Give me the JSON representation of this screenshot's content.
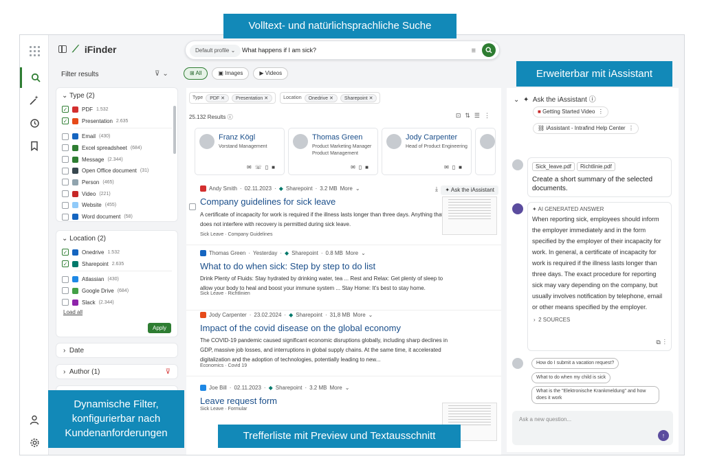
{
  "callouts": {
    "top": "Volltext- und natürlichsprachliche Suche",
    "right": "Erweiterbar mit iAssistant",
    "left": "Dynamische Filter, konfigurierbar nach Kundenanforderungen",
    "bottom": "Trefferliste mit Preview und Textausschnitt"
  },
  "app": {
    "name": "iFinder"
  },
  "search": {
    "profile": "Default profile",
    "query": "What happens if I am sick?"
  },
  "filters": {
    "header": "Filter results",
    "type": {
      "title": "Type (2)",
      "items": [
        {
          "label": "PDF",
          "count": "1.532",
          "checked": true,
          "color": "#d32f2f"
        },
        {
          "label": "Presentation",
          "count": "2.635",
          "checked": true,
          "color": "#e64a19"
        },
        {
          "label": "Email",
          "count": "(430)",
          "checked": false,
          "color": "#1565c0"
        },
        {
          "label": "Excel spreadsheet",
          "count": "(684)",
          "checked": false,
          "color": "#2e7d32"
        },
        {
          "label": "Message",
          "count": "(2.344)",
          "checked": false,
          "color": "#2e7d32"
        },
        {
          "label": "Open Office document",
          "count": "(31)",
          "checked": false,
          "color": "#37474f"
        },
        {
          "label": "Person",
          "count": "(465)",
          "checked": false,
          "color": "#90a4ae"
        },
        {
          "label": "Video",
          "count": "(221)",
          "checked": false,
          "color": "#c62828"
        },
        {
          "label": "Website",
          "count": "(455)",
          "checked": false,
          "color": "#90caf9"
        },
        {
          "label": "Word document",
          "count": "(58)",
          "checked": false,
          "color": "#1565c0"
        }
      ]
    },
    "location": {
      "title": "Location (2)",
      "items": [
        {
          "label": "Onedrive",
          "count": "1.532",
          "checked": true,
          "color": "#1565c0"
        },
        {
          "label": "Sharepoint",
          "count": "2.635",
          "checked": true,
          "color": "#00796b"
        },
        {
          "label": "Atlassian",
          "count": "(430)",
          "checked": false,
          "color": "#1e88e5"
        },
        {
          "label": "Google Drive",
          "count": "(684)",
          "checked": false,
          "color": "#43a047"
        },
        {
          "label": "Slack",
          "count": "(2.344)",
          "checked": false,
          "color": "#8e24aa"
        }
      ],
      "load_all": "Load all",
      "apply": "Apply"
    },
    "date": "Date",
    "author": "Author (1)"
  },
  "tabs": [
    "All",
    "Images",
    "Videos"
  ],
  "active_filters": {
    "type_label": "Type",
    "type_chips": [
      "PDF",
      "Presentation"
    ],
    "location_label": "Location",
    "location_chips": [
      "Onedrive",
      "Sharepoint"
    ]
  },
  "results_count": "25.132 Results",
  "people": [
    {
      "name": "Franz Kögl",
      "role": "Vorstand Management"
    },
    {
      "name": "Thomas Green",
      "role": "Product Marketing Manager Product Management"
    },
    {
      "name": "Jody Carpenter",
      "role": "Head of Product Engineering"
    }
  ],
  "results": [
    {
      "author": "Andy Smith",
      "date": "02.11.2023",
      "source": "Sharepoint",
      "size": "3.2 MB",
      "more": "More",
      "title": "Company guidelines for sick leave",
      "text": "A certificate of incapacity for work is required if the illness lasts longer than three days. Anything that does not interfere with recovery is permitted during sick leave.",
      "tags": "Sick Leave · Company Guidelines",
      "ask": "Ask the iAssistant",
      "filecolor": "#d32f2f"
    },
    {
      "author": "Thomas Green",
      "date": "Yesterday",
      "source": "Sharepoint",
      "size": "0.8 MB",
      "more": "More",
      "title": "What to do when sick: Step by step to do list",
      "text": "Drink Plenty of Fluids: Stay hydrated by drinking water, tea ... Rest and Relax: Get plenty of sleep to allow your body to heal and boost your immune system ... Stay Home: It's best to stay home.",
      "tags": "Sick Leave · Richtlinien",
      "filecolor": "#1565c0"
    },
    {
      "author": "Jody Carpenter",
      "date": "23.02.2024",
      "source": "Sharepoint",
      "size": "31,8 MB",
      "more": "More",
      "title": "Impact of the covid disease on the global economy",
      "text": "The COVID-19 pandemic caused significant economic disruptions globally, including sharp declines in GDP, massive job losses, and interruptions in global supply chains. At the same time, it accelerated digitalization and the adoption of technologies, potentially leading to new...",
      "tags": "Economics · Covid 19",
      "filecolor": "#e64a19"
    },
    {
      "author": "Joe Bill",
      "date": "02.11.2023",
      "source": "Sharepoint",
      "size": "3.2 MB",
      "more": "More",
      "title": "Leave request form",
      "text": "",
      "tags": "Sick Leave · Formular",
      "filecolor": "#1e88e5"
    }
  ],
  "assistant": {
    "title": "Ask the iAssistant",
    "links": [
      "Getting Started Video",
      "iAssistant - Intrafind Help Center"
    ],
    "user_files": [
      "Sick_leave.pdf",
      "Richtlinie.pdf"
    ],
    "user_prompt": "Create a short summary of the selected documents.",
    "ai_label": "AI GENERATED ANSWER",
    "answer": "When reporting sick, employees should inform the employer immediately and in the form specified by the employer of their incapacity for work. In general, a certificate of incapacity for work is required if the illness lasts longer than three days. The exact procedure for reporting sick may vary depending on the company, but usually involves notification by telephone, email or other means specified by the employer.",
    "sources": "2 SOURCES",
    "suggestions": [
      "How do I submit a vacation request?",
      "What to do when my child is sick",
      "What is the \"Elektronische Krankmeldung\" and how does it work"
    ],
    "placeholder": "Ask a new question..."
  }
}
